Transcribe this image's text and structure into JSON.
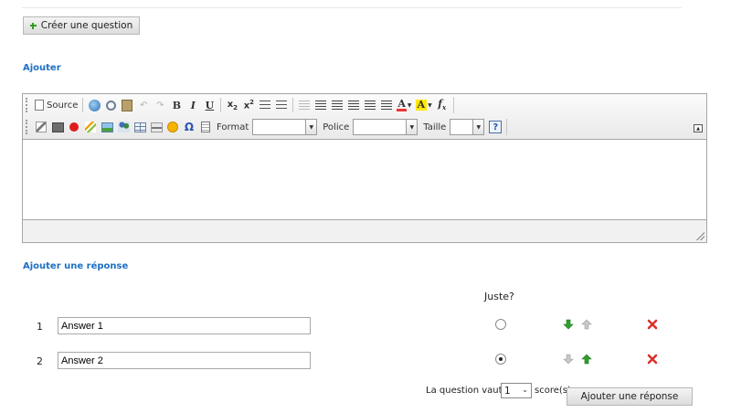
{
  "create_question": {
    "label": "Créer une question"
  },
  "section_add": {
    "title": "Ajouter"
  },
  "editor": {
    "toolbar_row1": {
      "source_label": "Source"
    },
    "toolbar_row2": {
      "format_label": "Format",
      "police_label": "Police",
      "taille_label": "Taille",
      "help_glyph": "?"
    },
    "content": ""
  },
  "section_answer": {
    "title": "Ajouter une réponse"
  },
  "answers_table": {
    "column_correct": "Juste?",
    "rows": [
      {
        "number": "1",
        "value": "Answer 1",
        "checked": false
      },
      {
        "number": "2",
        "value": "Answer 2",
        "checked": true
      }
    ]
  },
  "footer": {
    "text_before": "La question vaut",
    "score_value": "1",
    "text_after": "score(s)",
    "add_answer_label": "Ajouter une réponse"
  },
  "colors": {
    "section_title": "#1d6fc2",
    "arrow_green": "#2ea12a",
    "arrow_gray": "#b5b5b5",
    "delete_red": "#d9322b"
  }
}
